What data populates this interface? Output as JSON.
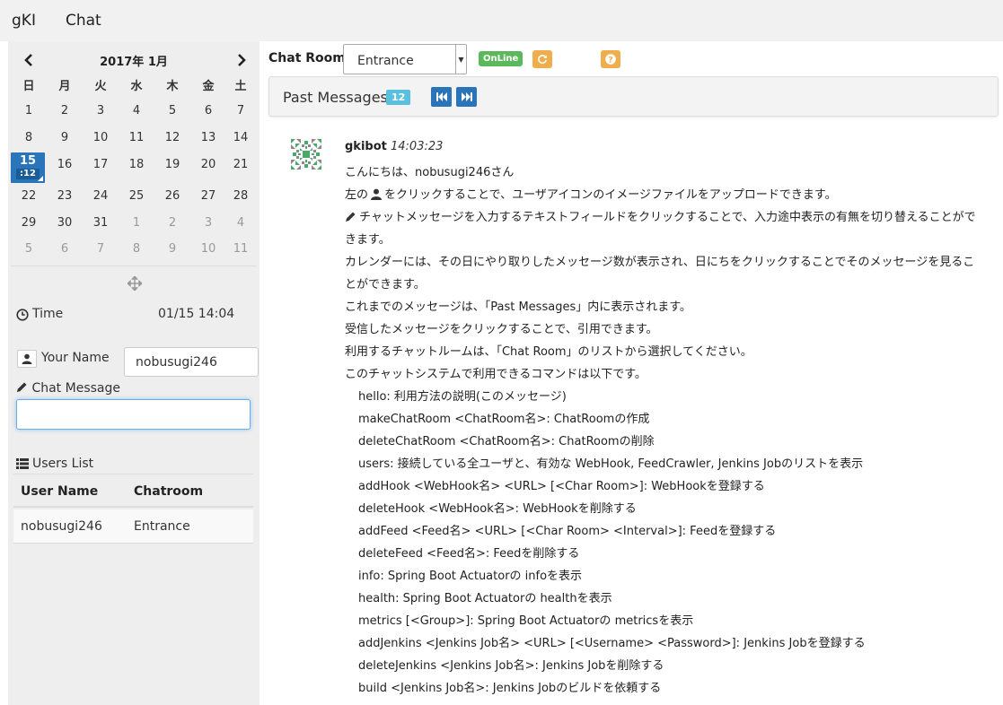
{
  "nav": {
    "brand": "gKI",
    "chat": "Chat"
  },
  "calendar": {
    "title": "2017年 1月",
    "weekdays": [
      "日",
      "月",
      "火",
      "水",
      "木",
      "金",
      "土"
    ],
    "weeks": [
      [
        "1",
        "2",
        "3",
        "4",
        "5",
        "6",
        "7"
      ],
      [
        "8",
        "9",
        "10",
        "11",
        "12",
        "13",
        "14"
      ],
      [
        "15",
        "16",
        "17",
        "18",
        "19",
        "20",
        "21"
      ],
      [
        "22",
        "23",
        "24",
        "25",
        "26",
        "27",
        "28"
      ],
      [
        "29",
        "30",
        "31",
        "1",
        "2",
        "3",
        "4"
      ],
      [
        "5",
        "6",
        "7",
        "8",
        "9",
        "10",
        "11"
      ]
    ],
    "today_count": ":12"
  },
  "time": {
    "label": "Time",
    "value": "01/15 14:04"
  },
  "your_name": {
    "label": "Your Name",
    "value": "nobusugi246"
  },
  "chat_message": {
    "label": "Chat Message",
    "value": ""
  },
  "users": {
    "title": "Users List",
    "columns": [
      "User Name",
      "Chatroom"
    ],
    "rows": [
      [
        "nobusugi246",
        "Entrance"
      ]
    ]
  },
  "toolbar": {
    "room_label": "Chat Room",
    "room_value": "Entrance",
    "status": "OnLine"
  },
  "past": {
    "title": "Past Messages",
    "count": "12"
  },
  "message": {
    "user": "gkibot",
    "time": "14:03:23",
    "lines": [
      "こんにちは、nobusugi246さん",
      "左の",
      "をクリックすることで、ユーザアイコンのイメージファイルをアップロードできます。",
      "チャットメッセージを入力するテキストフィールドをクリックすることで、入力途中表示の有無を切り替えることができます。",
      "カレンダーには、その日にやり取りしたメッセージ数が表示され、日にちをクリックすることでそのメッセージを見ることができます。",
      "これまでのメッセージは、「Past Messages」内に表示されます。",
      "受信したメッセージをクリックすることで、引用できます。",
      "利用するチャットルームは、「Chat Room」のリストから選択してください。",
      "このチャットシステムで利用できるコマンドは以下です。"
    ],
    "commands": [
      "hello: 利用方法の説明(このメッセージ)",
      "makeChatRoom <ChatRoom名>: ChatRoomの作成",
      "deleteChatRoom <ChatRoom名>: ChatRoomの削除",
      "users: 接続している全ユーザと、有効な WebHook, FeedCrawler, Jenkins Jobのリストを表示",
      "addHook <WebHook名> <URL> [<Char Room>]: WebHookを登録する",
      "deleteHook <WebHook名>: WebHookを削除する",
      "addFeed <Feed名> <URL> [<Char Room> <Interval>]: Feedを登録する",
      "deleteFeed <Feed名>: Feedを削除する",
      "info: Spring Boot Actuatorの infoを表示",
      "health: Spring Boot Actuatorの healthを表示",
      "metrics [<Group>]: Spring Boot Actuatorの metricsを表示",
      "addJenkins <Jenkins Job名> <URL> [<Username> <Password>]: Jenkins Jobを登録する",
      "deleteJenkins <Jenkins Job名>: Jenkins Jobを削除する",
      "build <Jenkins Job名>: Jenkins Jobのビルドを依頼する"
    ]
  },
  "colors": {
    "primary": "#2a74b9",
    "success": "#5cb85c",
    "warning": "#f0ad4e",
    "info": "#5bc0de"
  }
}
